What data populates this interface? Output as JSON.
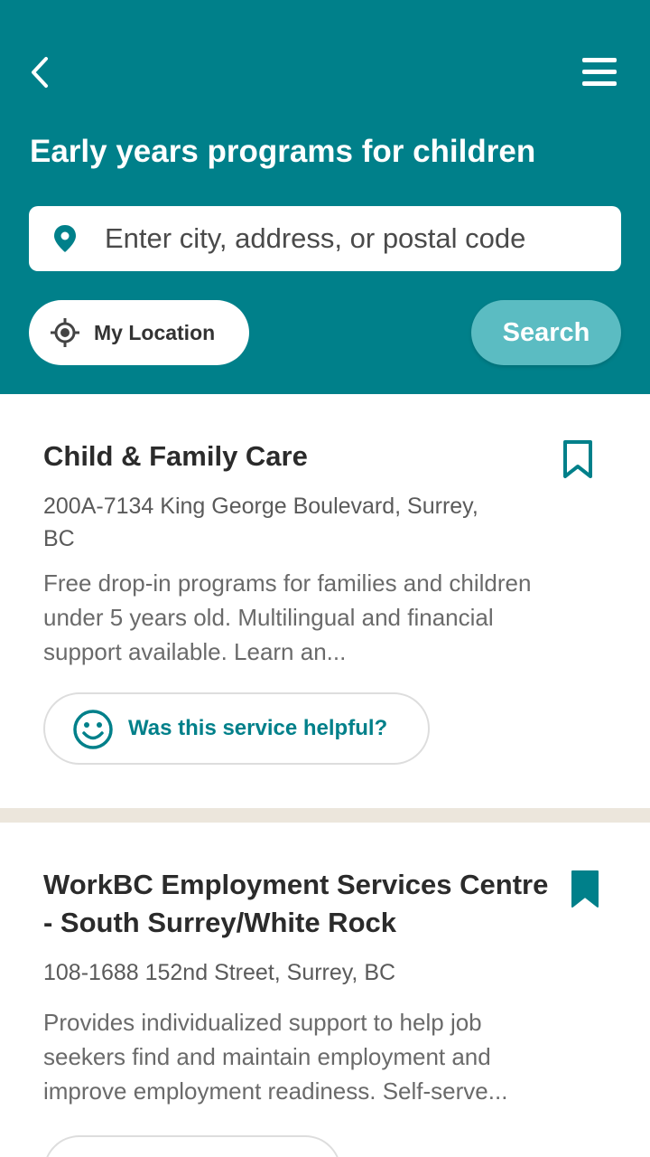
{
  "header": {
    "title": "Early years programs for children",
    "search_placeholder": "Enter city, address, or postal code",
    "my_location_label": "My Location",
    "search_label": "Search"
  },
  "colors": {
    "brand": "#00808a",
    "search_button": "#5bbcc2",
    "divider": "#ece6dc"
  },
  "icons": {
    "back": "back-arrow-icon",
    "menu": "hamburger-menu-icon",
    "pin": "location-pin-icon",
    "target": "crosshair-location-icon",
    "bookmark": "bookmark-icon",
    "smile": "smiley-face-icon"
  },
  "results": [
    {
      "title": "Child & Family Care",
      "address": "200A-7134 King George Boulevard, Surrey, BC",
      "description": "Free drop-in programs for families and children under 5 years old. Multilingual and financial support available. Learn an...",
      "bookmarked": false,
      "feedback_label": "Was this service helpful?"
    },
    {
      "title": "WorkBC Employment Services Centre - South Surrey/White Rock",
      "address": "108-1688 152nd Street, Surrey, BC",
      "description": "Provides individualized support to help job seekers find and maintain employment and improve employment readiness. Self-serve...",
      "bookmarked": true
    }
  ]
}
